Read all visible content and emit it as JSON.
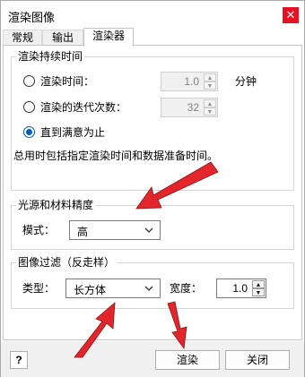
{
  "window": {
    "title": "渲染图像",
    "close_glyph": "✕"
  },
  "tabs": [
    {
      "label": "常规",
      "active": false
    },
    {
      "label": "输出",
      "active": false
    },
    {
      "label": "渲染器",
      "active": true
    }
  ],
  "duration": {
    "title": "渲染持续时间",
    "option_time": {
      "label": "渲染时间：",
      "checked": false,
      "value": "1.0",
      "unit": "分钟"
    },
    "option_iterations": {
      "label": "渲染的迭代次数：",
      "checked": false,
      "value": "32"
    },
    "option_satisfied": {
      "label": "直到满意为止",
      "checked": true
    },
    "note": "总用时包括指定渲染时间和数据准备时间。"
  },
  "lighting": {
    "title": "光源和材料精度",
    "mode_label": "模式：",
    "mode_value": "高"
  },
  "filter": {
    "title": "图像过滤（反走样）",
    "type_label": "类型：",
    "type_value": "长方体",
    "width_label": "宽度：",
    "width_value": "1.0"
  },
  "footer": {
    "help_glyph": "?",
    "render_button": "渲染",
    "close_button": "关闭"
  },
  "colors": {
    "annotation_arrow": "#e3262b",
    "accent": "#005fb8",
    "close": "#e81123"
  }
}
